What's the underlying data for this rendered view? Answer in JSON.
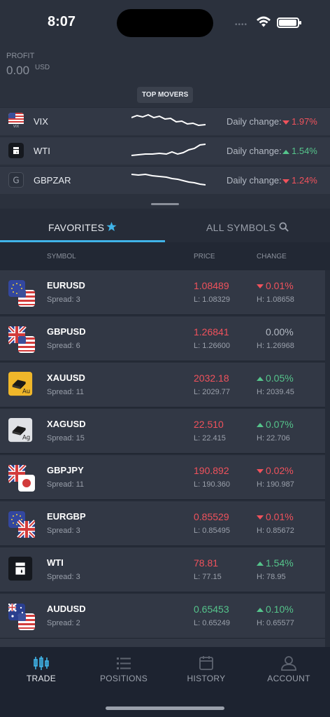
{
  "status_bar": {
    "time": "8:07",
    "dots": "••••"
  },
  "profit": {
    "label": "PROFIT",
    "value": "0.00",
    "unit": "USD"
  },
  "top_movers": {
    "badge": "TOP MOVERS",
    "daily_label": "Daily change:",
    "items": [
      {
        "symbol": "VIX",
        "direction": "down",
        "change": "1.97%",
        "icon": "us-flag-icon"
      },
      {
        "symbol": "WTI",
        "direction": "up",
        "change": "1.54%",
        "icon": "oil-barrel-icon"
      },
      {
        "symbol": "GBPZAR",
        "direction": "down",
        "change": "1.24%",
        "icon": "g-letter-icon",
        "icon_text": "G"
      }
    ]
  },
  "tabs": {
    "favorites": "FAVORITES",
    "all_symbols": "ALL SYMBOLS",
    "active": "favorites"
  },
  "columns": {
    "symbol": "SYMBOL",
    "price": "PRICE",
    "change": "CHANGE"
  },
  "symbols": [
    {
      "symbol": "EURUSD",
      "spread": "Spread: 3",
      "price": "1.08489",
      "low": "L: 1.08329",
      "change": "0.01%",
      "high": "H: 1.08658",
      "direction": "down",
      "price_color": "neg"
    },
    {
      "symbol": "GBPUSD",
      "spread": "Spread: 6",
      "price": "1.26841",
      "low": "L: 1.26600",
      "change": "0.00%",
      "high": "H: 1.26968",
      "direction": "none",
      "price_color": "neg"
    },
    {
      "symbol": "XAUUSD",
      "spread": "Spread: 11",
      "price": "2032.18",
      "low": "L: 2029.77",
      "change": "0.05%",
      "high": "H: 2039.45",
      "direction": "up",
      "price_color": "neg"
    },
    {
      "symbol": "XAGUSD",
      "spread": "Spread: 15",
      "price": "22.510",
      "low": "L: 22.415",
      "change": "0.07%",
      "high": "H: 22.706",
      "direction": "up",
      "price_color": "neg"
    },
    {
      "symbol": "GBPJPY",
      "spread": "Spread: 11",
      "price": "190.892",
      "low": "L: 190.360",
      "change": "0.02%",
      "high": "H: 190.987",
      "direction": "down",
      "price_color": "neg"
    },
    {
      "symbol": "EURGBP",
      "spread": "Spread: 3",
      "price": "0.85529",
      "low": "L: 0.85495",
      "change": "0.01%",
      "high": "H: 0.85672",
      "direction": "down",
      "price_color": "neg"
    },
    {
      "symbol": "WTI",
      "spread": "Spread: 3",
      "price": "78.81",
      "low": "L: 77.15",
      "change": "1.54%",
      "high": "H: 78.95",
      "direction": "up",
      "price_color": "neg"
    },
    {
      "symbol": "AUDUSD",
      "spread": "Spread: 2",
      "price": "0.65453",
      "low": "L: 0.65249",
      "change": "0.10%",
      "high": "H: 0.65577",
      "direction": "up",
      "price_color": "pos"
    }
  ],
  "gold_label": "Au",
  "silver_label": "Ag",
  "bottom_nav": [
    {
      "label": "TRADE",
      "icon": "candlestick-chart-icon",
      "active": true
    },
    {
      "label": "POSITIONS",
      "icon": "list-icon",
      "active": false
    },
    {
      "label": "HISTORY",
      "icon": "calendar-icon",
      "active": false
    },
    {
      "label": "ACCOUNT",
      "icon": "user-icon",
      "active": false
    }
  ],
  "colors": {
    "accent": "#40b4e8",
    "negative": "#f0525c",
    "positive": "#55c48b",
    "background": "#262c38",
    "row": "#323845"
  }
}
